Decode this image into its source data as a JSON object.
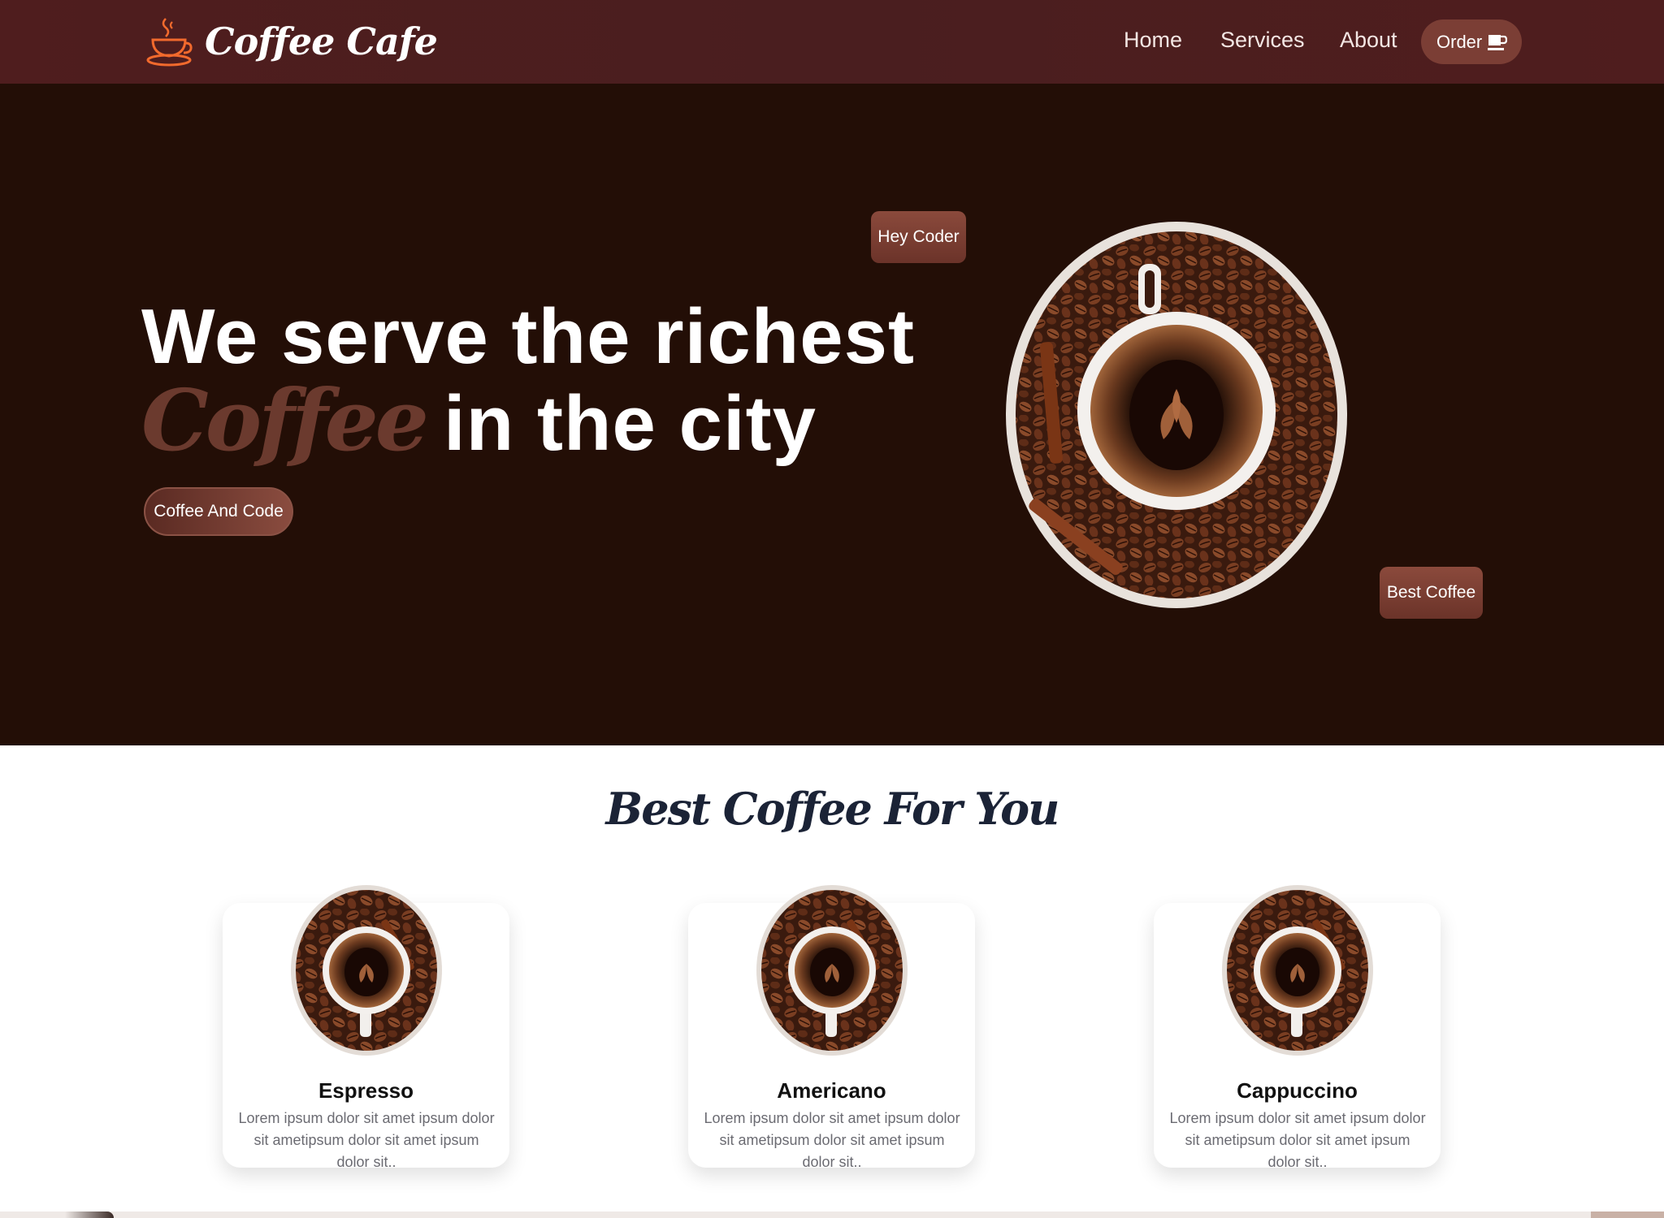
{
  "brand": {
    "name": "Coffee Cafe",
    "icon": "coffee-cup-icon"
  },
  "nav": {
    "items": [
      {
        "label": "Home"
      },
      {
        "label": "Services"
      },
      {
        "label": "About"
      }
    ],
    "order_label": "Order",
    "order_icon": "cup-icon"
  },
  "hero": {
    "line1": "We serve the richest",
    "accent": "Coffee",
    "line2_rest": "in the city",
    "cta_label": "Coffee And Code",
    "tag_top": "Hey Coder",
    "tag_bottom": "Best Coffee",
    "image": "coffee-cup-with-beans"
  },
  "section": {
    "title": "Best Coffee For You",
    "cards": [
      {
        "title": "Espresso",
        "desc": "Lorem ipsum dolor sit amet ipsum dolor sit ametipsum dolor sit amet ipsum dolor sit.."
      },
      {
        "title": "Americano",
        "desc": "Lorem ipsum dolor sit amet ipsum dolor sit ametipsum dolor sit amet ipsum dolor sit.."
      },
      {
        "title": "Cappuccino",
        "desc": "Lorem ipsum dolor sit amet ipsum dolor sit ametipsum dolor sit amet ipsum dolor sit.."
      }
    ]
  },
  "colors": {
    "navbar": "#4f1d1e",
    "hero_bg": "#230e06",
    "accent": "#6b3a2e",
    "button": "#7b3e35",
    "title_text": "#1b2336"
  }
}
